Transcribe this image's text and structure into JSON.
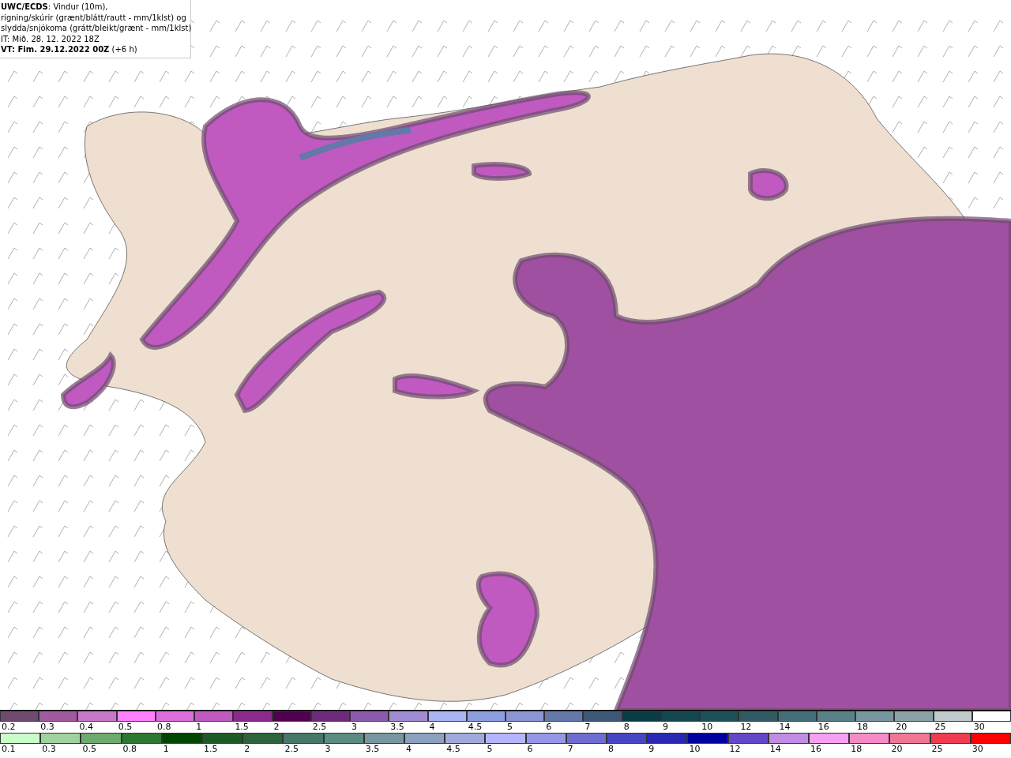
{
  "title_box": {
    "lines": [
      "**UWC/ECDS**: Vindur (10m),",
      "rigning/skúrir (grænt/blátt/rautt - mm/1klst) og",
      "slydda/snjókoma (grátt/bleikt/grænt - mm/1klst)",
      "IT: Mið. 28. 12. 2022 18Z",
      "**VT: Fim. 29.12.2022 00Z** (+6 h)"
    ]
  },
  "legend": [
    {
      "items": [
        {
          "label": "0.2",
          "color": "#6e4a6e"
        },
        {
          "label": "0.3",
          "color": "#a05aa0"
        },
        {
          "label": "0.4",
          "color": "#c878c8"
        },
        {
          "label": "0.5",
          "color": "#ff80ff"
        },
        {
          "label": "0.8",
          "color": "#dc6edc"
        },
        {
          "label": "1",
          "color": "#c05ac0"
        },
        {
          "label": "1.5",
          "color": "#8c2a8c"
        },
        {
          "label": "2",
          "color": "#500050"
        },
        {
          "label": "2.5",
          "color": "#6e2a7a"
        },
        {
          "label": "3",
          "color": "#8c5aaa"
        },
        {
          "label": "3.5",
          "color": "#a08cd2"
        },
        {
          "label": "4",
          "color": "#aab4f5"
        },
        {
          "label": "4.5",
          "color": "#8c9ee0"
        },
        {
          "label": "5",
          "color": "#8c96d2"
        },
        {
          "label": "6",
          "color": "#6478aa"
        },
        {
          "label": "7",
          "color": "#3c5a78"
        },
        {
          "label": "8",
          "color": "#0a3c46"
        },
        {
          "label": "9",
          "color": "#144650"
        },
        {
          "label": "10",
          "color": "#1e5058"
        },
        {
          "label": "12",
          "color": "#325a64"
        },
        {
          "label": "14",
          "color": "#466e78"
        },
        {
          "label": "16",
          "color": "#5a8088"
        },
        {
          "label": "18",
          "color": "#7896a0"
        },
        {
          "label": "20",
          "color": "#8ca0a8"
        },
        {
          "label": "25",
          "color": "#c0cacc"
        },
        {
          "label": "30",
          "color": "#ffffff"
        }
      ]
    },
    {
      "items": [
        {
          "label": "0.1",
          "color": "#c8ffc8"
        },
        {
          "label": "0.3",
          "color": "#a0d2a0"
        },
        {
          "label": "0.5",
          "color": "#6eaa6e"
        },
        {
          "label": "0.8",
          "color": "#2d7830"
        },
        {
          "label": "1",
          "color": "#004600"
        },
        {
          "label": "1.5",
          "color": "#1e5a28"
        },
        {
          "label": "2",
          "color": "#2d643c"
        },
        {
          "label": "2.5",
          "color": "#46786a"
        },
        {
          "label": "3",
          "color": "#5a8c82"
        },
        {
          "label": "3.5",
          "color": "#7896a0"
        },
        {
          "label": "4",
          "color": "#8ca0c0"
        },
        {
          "label": "4.5",
          "color": "#a0aadc"
        },
        {
          "label": "5",
          "color": "#b4b4ff"
        },
        {
          "label": "6",
          "color": "#9696e6"
        },
        {
          "label": "7",
          "color": "#6e6ed2"
        },
        {
          "label": "8",
          "color": "#4646c3"
        },
        {
          "label": "9",
          "color": "#2828b4"
        },
        {
          "label": "10",
          "color": "#0000a0"
        },
        {
          "label": "12",
          "color": "#6446c8"
        },
        {
          "label": "14",
          "color": "#c08ce6"
        },
        {
          "label": "16",
          "color": "#f5a0f0"
        },
        {
          "label": "18",
          "color": "#f58cc8"
        },
        {
          "label": "20",
          "color": "#f07896"
        },
        {
          "label": "25",
          "color": "#f03c50"
        },
        {
          "label": "30",
          "color": "#ff0000"
        }
      ]
    }
  ]
}
